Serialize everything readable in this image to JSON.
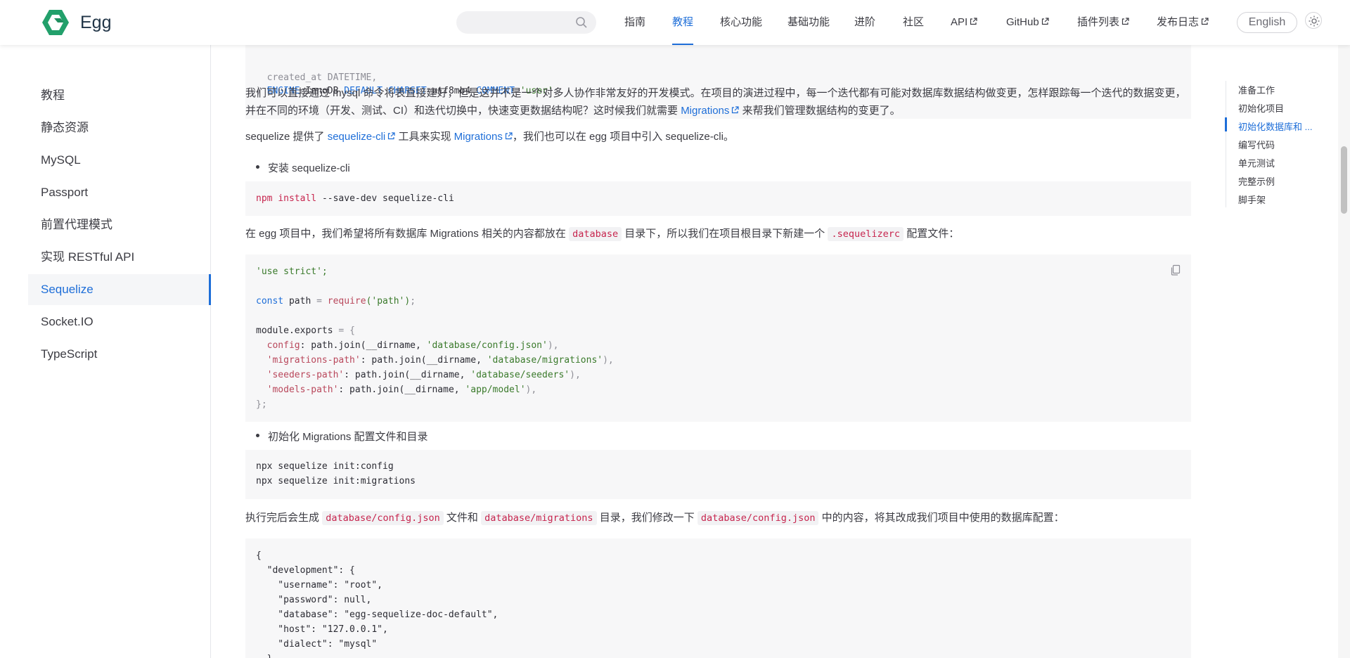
{
  "brand": {
    "name": "Egg"
  },
  "search": {
    "placeholder": ""
  },
  "nav": {
    "items": [
      {
        "label": "指南"
      },
      {
        "label": "教程"
      },
      {
        "label": "核心功能"
      },
      {
        "label": "基础功能"
      },
      {
        "label": "进阶"
      },
      {
        "label": "社区"
      },
      {
        "label": "API"
      },
      {
        "label": "GitHub"
      },
      {
        "label": "插件列表"
      },
      {
        "label": "发布日志"
      }
    ],
    "active": "教程",
    "language": "English"
  },
  "sidebar": {
    "items": [
      {
        "label": "教程"
      },
      {
        "label": "静态资源"
      },
      {
        "label": "MySQL"
      },
      {
        "label": "Passport"
      },
      {
        "label": "前置代理模式"
      },
      {
        "label": "实现 RESTful API"
      },
      {
        "label": "Sequelize"
      },
      {
        "label": "Socket.IO"
      },
      {
        "label": "TypeScript"
      }
    ],
    "active": "Sequelize"
  },
  "content": {
    "code_top": {
      "line_partial": "  created_at DATETIME,",
      "line": {
        "p1": ") ",
        "engine_kw": "ENGINE",
        "eq1": "=",
        "engine_val": "InnoDB",
        "default_kw": "DEFAULT",
        "charset_kw": "CHARSET",
        "eq2": "=",
        "charset_val": "utf8mb4",
        "comment_kw": "COMMENT",
        "eq3": "=",
        "comment_val": "'user'",
        "end": ";"
      }
    },
    "p1": {
      "text": "我们可以直接通过 mysql 命令将表直接建好，但是这并不是一个对多人协作非常友好的开发模式。在项目的演进过程中，每一个迭代都有可能对数据库数据结构做变更，怎样跟踪每一个迭代的数据变更，",
      "line2": "并在不同的环境（开发、测试、CI）和迭代切换中，快速变更数据结构呢？这时候我们就需要",
      "link": "Migrations",
      "tail": "来帮我们管理数据结构的变更了。"
    },
    "p2": {
      "prefix": "sequelize 提供了",
      "link1": "sequelize-cli",
      "mid": "工具来实现",
      "link2": "Migrations",
      "tail": "，我们也可以在 egg 项目中引入 sequelize-cli。"
    },
    "bullet1": "安装 sequelize-cli",
    "code_install": {
      "cmd1": "npm",
      "cmd2": "install",
      "rest": "--save-dev sequelize-cli"
    },
    "p3": {
      "prefix": "在 egg 项目中，我们希望将所有数据库 Migrations 相关的内容都放在",
      "code1": "database",
      "mid": "目录下，所以我们在项目根目录下新建一个",
      "code2": ".sequelizerc",
      "tail": "配置文件："
    },
    "code_rc": {
      "l1": "'use strict';",
      "l2_const": "const",
      "l2_path": " path ",
      "l2_eq": "=",
      "l2_req": " require",
      "l2_arg": "('path')",
      "l2_end": ";",
      "l3a": "module",
      "l3b": ".exports ",
      "l3c": "= {",
      "l4_key": "  config",
      "l4_rest": ": path.join(__dirname, ",
      "l4_str": "'database/config.json'",
      "l4_end": "),",
      "l5_key": "  'migrations-path'",
      "l5_rest": ": path.join(__dirname, ",
      "l5_str": "'database/migrations'",
      "l5_end": "),",
      "l6_key": "  'seeders-path'",
      "l6_rest": ": path.join(__dirname, ",
      "l6_str": "'database/seeders'",
      "l6_end": "),",
      "l7_key": "  'models-path'",
      "l7_rest": ": path.join(__dirname, ",
      "l7_str": "'app/model'",
      "l7_end": "),",
      "l8": "};"
    },
    "bullet2": "初始化 Migrations 配置文件和目录",
    "code_init": {
      "l1": "npx sequelize init:config",
      "l2": "npx sequelize init:migrations"
    },
    "p4": {
      "prefix": "执行完后会生成",
      "code1": "database/config.json",
      "mid1": "文件和",
      "code2": "database/migrations",
      "mid2": "目录，我们修改一下",
      "code3": "database/config.json",
      "tail": "中的内容，将其改成我们项目中使用的数据库配置："
    },
    "code_json": {
      "l1": "{",
      "l2": "  \"development\": {",
      "l3": "    \"username\": \"root\",",
      "l4": "    \"password\": null,",
      "l5": "    \"database\": \"egg-sequelize-doc-default\",",
      "l6": "    \"host\": \"127.0.0.1\",",
      "l7": "    \"dialect\": \"mysql\"",
      "l8": "  },"
    }
  },
  "outline": {
    "items": [
      {
        "label": "准备工作"
      },
      {
        "label": "初始化项目"
      },
      {
        "label": "初始化数据库和 ..."
      },
      {
        "label": "编写代码"
      },
      {
        "label": "单元测试"
      },
      {
        "label": "完整示例"
      },
      {
        "label": "脚手架"
      }
    ],
    "active": "初始化数据库和 ..."
  },
  "colors": {
    "accent": "#1e6ed8",
    "code_bg": "#f7f7f8",
    "inline_code": "#c7254e"
  }
}
